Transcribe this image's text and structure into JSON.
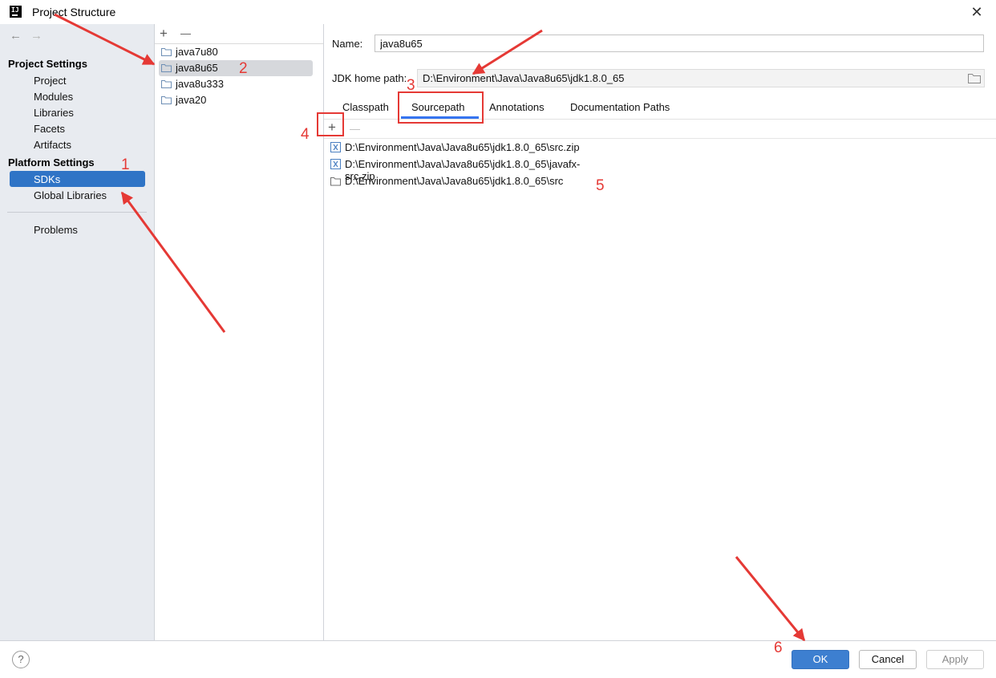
{
  "window": {
    "title": "Project Structure"
  },
  "sidebar": {
    "back_icon": "arrow-left",
    "forward_icon": "arrow-right",
    "project_settings_title": "Project Settings",
    "project_items": [
      "Project",
      "Modules",
      "Libraries",
      "Facets",
      "Artifacts"
    ],
    "platform_settings_title": "Platform Settings",
    "platform_items": [
      "SDKs",
      "Global Libraries"
    ],
    "selected_item": "SDKs",
    "problems_label": "Problems"
  },
  "sdk_list": {
    "add_icon": "+",
    "remove_icon": "—",
    "items": [
      "java7u80",
      "java8u65",
      "java8u333",
      "java20"
    ],
    "selected": "java8u65"
  },
  "detail": {
    "name_label": "Name:",
    "name_value": "java8u65",
    "jdk_home_label": "JDK home path:",
    "jdk_home_value": "D:\\Environment\\Java\\Java8u65\\jdk1.8.0_65",
    "tabs": [
      "Classpath",
      "Sourcepath",
      "Annotations",
      "Documentation Paths"
    ],
    "active_tab": "Sourcepath",
    "path_add_icon": "+",
    "path_remove_icon": "—",
    "paths": [
      {
        "icon": "archive-icon",
        "text": "D:\\Environment\\Java\\Java8u65\\jdk1.8.0_65\\src.zip"
      },
      {
        "icon": "archive-icon",
        "text": "D:\\Environment\\Java\\Java8u65\\jdk1.8.0_65\\javafx-src.zip"
      },
      {
        "icon": "folder-icon",
        "text": "D:\\Environment\\Java\\Java8u65\\jdk1.8.0_65\\src"
      }
    ]
  },
  "footer": {
    "help_label": "?",
    "ok_label": "OK",
    "cancel_label": "Cancel",
    "apply_label": "Apply"
  },
  "annotations": {
    "color": "#e53935",
    "steps": [
      "1",
      "2",
      "3",
      "4",
      "5",
      "6"
    ]
  }
}
